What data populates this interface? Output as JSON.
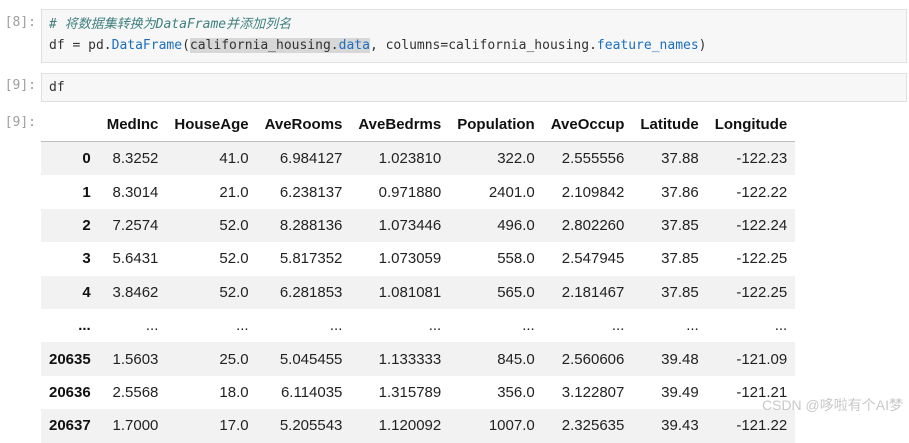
{
  "cells": {
    "cell8": {
      "prompt": "[8]:",
      "comment": "# 将数据集转换为DataFrame并添加列名",
      "code": {
        "p1": "df = pd.",
        "p2": "DataFrame",
        "p3": "(",
        "p4": "california_housing.",
        "p5": "data",
        "p6": ", columns=california_housing.",
        "p7": "feature_names",
        "p8": ")"
      }
    },
    "cell9": {
      "prompt": "[9]:",
      "code": "df"
    },
    "output9": {
      "prompt": "[9]:"
    }
  },
  "table": {
    "columns": [
      "",
      "MedInc",
      "HouseAge",
      "AveRooms",
      "AveBedrms",
      "Population",
      "AveOccup",
      "Latitude",
      "Longitude"
    ],
    "rows": [
      [
        "0",
        "8.3252",
        "41.0",
        "6.984127",
        "1.023810",
        "322.0",
        "2.555556",
        "37.88",
        "-122.23"
      ],
      [
        "1",
        "8.3014",
        "21.0",
        "6.238137",
        "0.971880",
        "2401.0",
        "2.109842",
        "37.86",
        "-122.22"
      ],
      [
        "2",
        "7.2574",
        "52.0",
        "8.288136",
        "1.073446",
        "496.0",
        "2.802260",
        "37.85",
        "-122.24"
      ],
      [
        "3",
        "5.6431",
        "52.0",
        "5.817352",
        "1.073059",
        "558.0",
        "2.547945",
        "37.85",
        "-122.25"
      ],
      [
        "4",
        "3.8462",
        "52.0",
        "6.281853",
        "1.081081",
        "565.0",
        "2.181467",
        "37.85",
        "-122.25"
      ],
      [
        "...",
        "...",
        "...",
        "...",
        "...",
        "...",
        "...",
        "...",
        "..."
      ],
      [
        "20635",
        "1.5603",
        "25.0",
        "5.045455",
        "1.133333",
        "845.0",
        "2.560606",
        "39.48",
        "-121.09"
      ],
      [
        "20636",
        "2.5568",
        "18.0",
        "6.114035",
        "1.315789",
        "356.0",
        "3.122807",
        "39.49",
        "-121.21"
      ],
      [
        "20637",
        "1.7000",
        "17.0",
        "5.205543",
        "1.120092",
        "1007.0",
        "2.325635",
        "39.43",
        "-121.22"
      ]
    ]
  },
  "watermark": "CSDN @哆啦有个AI梦"
}
